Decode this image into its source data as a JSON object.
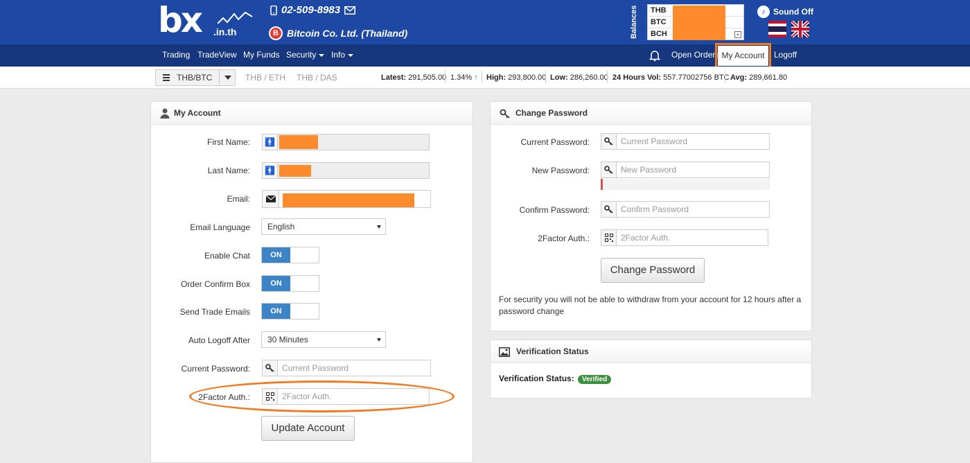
{
  "header": {
    "logo_text": "bx",
    "logo_sub": ".in.th",
    "phone": "02-509-8983",
    "company": "Bitcoin Co. Ltd. (Thailand)",
    "balances_label": "Balances",
    "balances": [
      "THB",
      "BTC",
      "BCH"
    ],
    "sound": "Sound Off"
  },
  "nav": {
    "items": [
      "Trading",
      "TradeView",
      "My Funds",
      "Security",
      "Info"
    ],
    "open_orders": "Open Orders",
    "my_account": "My Account",
    "logoff": "Logoff"
  },
  "ticker": {
    "pair": "THB/BTC",
    "other_pairs": [
      "THB / ETH",
      "THB / DAS"
    ],
    "latest_label": "Latest:",
    "latest": "291,505.00",
    "change": "1.34%",
    "high_label": "High:",
    "high": "293,800.00",
    "low_label": "Low:",
    "low": "286,260.00",
    "vol_label": "24 Hours Vol:",
    "vol": "557.77002756 BTC",
    "avg_label": "Avg:",
    "avg": "289,661.80"
  },
  "account": {
    "title": "My Account",
    "first_name_label": "First Name:",
    "last_name_label": "Last Name:",
    "email_label": "Email:",
    "email_language_label": "Email Language",
    "email_language": "English",
    "enable_chat_label": "Enable Chat",
    "order_confirm_label": "Order Confirm Box",
    "trade_emails_label": "Send Trade Emails",
    "toggle_on": "ON",
    "auto_logoff_label": "Auto Logoff After",
    "auto_logoff": "30 Minutes",
    "current_password_label": "Current Password:",
    "current_password_placeholder": "Current Password",
    "twofactor_label": "2Factor Auth.:",
    "twofactor_placeholder": "2Factor Auth.",
    "update_button": "Update Account"
  },
  "password": {
    "title": "Change Password",
    "current_label": "Current Password:",
    "current_placeholder": "Current Password",
    "new_label": "New Password:",
    "new_placeholder": "New Password",
    "confirm_label": "Confirm Password:",
    "confirm_placeholder": "Confirm Password",
    "twofactor_label": "2Factor Auth.:",
    "twofactor_placeholder": "2Factor Auth.",
    "button": "Change Password",
    "note": "For security you will not be able to withdraw from your account for 12 hours after a password change"
  },
  "verification": {
    "title": "Verification Status",
    "label": "Verification Status:",
    "status": "Verified"
  }
}
